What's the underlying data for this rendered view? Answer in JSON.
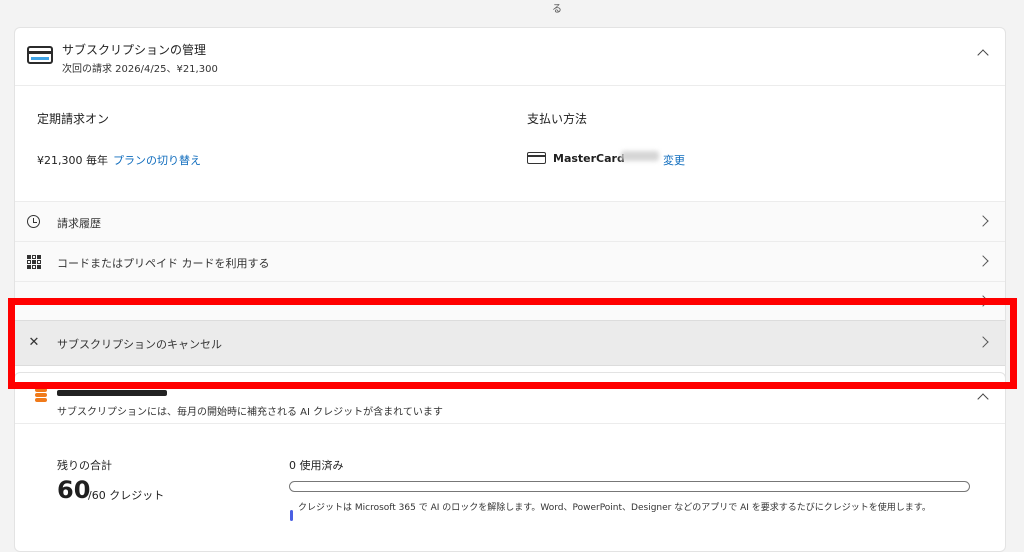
{
  "top_fragment": "る",
  "subscription": {
    "title": "サブスクリプションの管理",
    "next_billing": "次回の請求 2026/4/25、¥21,300",
    "auto_renew_label": "定期請求オン",
    "price_text": "¥21,300 毎年",
    "switch_plan_link": "プランの切り替え",
    "payment_label": "支払い方法",
    "payment_card": "MasterCard",
    "change_link": "変更"
  },
  "rows": [
    {
      "label": "請求履歴",
      "icon": "history-icon"
    },
    {
      "label": "コードまたはプリペイド カードを利用する",
      "icon": "qr-code-icon"
    },
    {
      "label": "サブスクリプションのキャンセル",
      "icon": "close-icon"
    }
  ],
  "ai_credits": {
    "subtitle": "サブスクリプションには、毎月の開始時に補充される AI クレジットが含まれています",
    "remaining_label": "残りの合計",
    "remaining_value": "60",
    "remaining_total": "/60 クレジット",
    "used_label": "0 使用済み",
    "usage_fraction": 0,
    "note": "クレジットは Microsoft 365 で AI のロックを解除します。Word、PowerPoint、Designer などのアプリで AI を要求するたびにクレジットを使用します。"
  },
  "colors": {
    "link": "#0f6cbd",
    "highlight": "#ff0000",
    "ai_icon": "#f07a1a"
  }
}
